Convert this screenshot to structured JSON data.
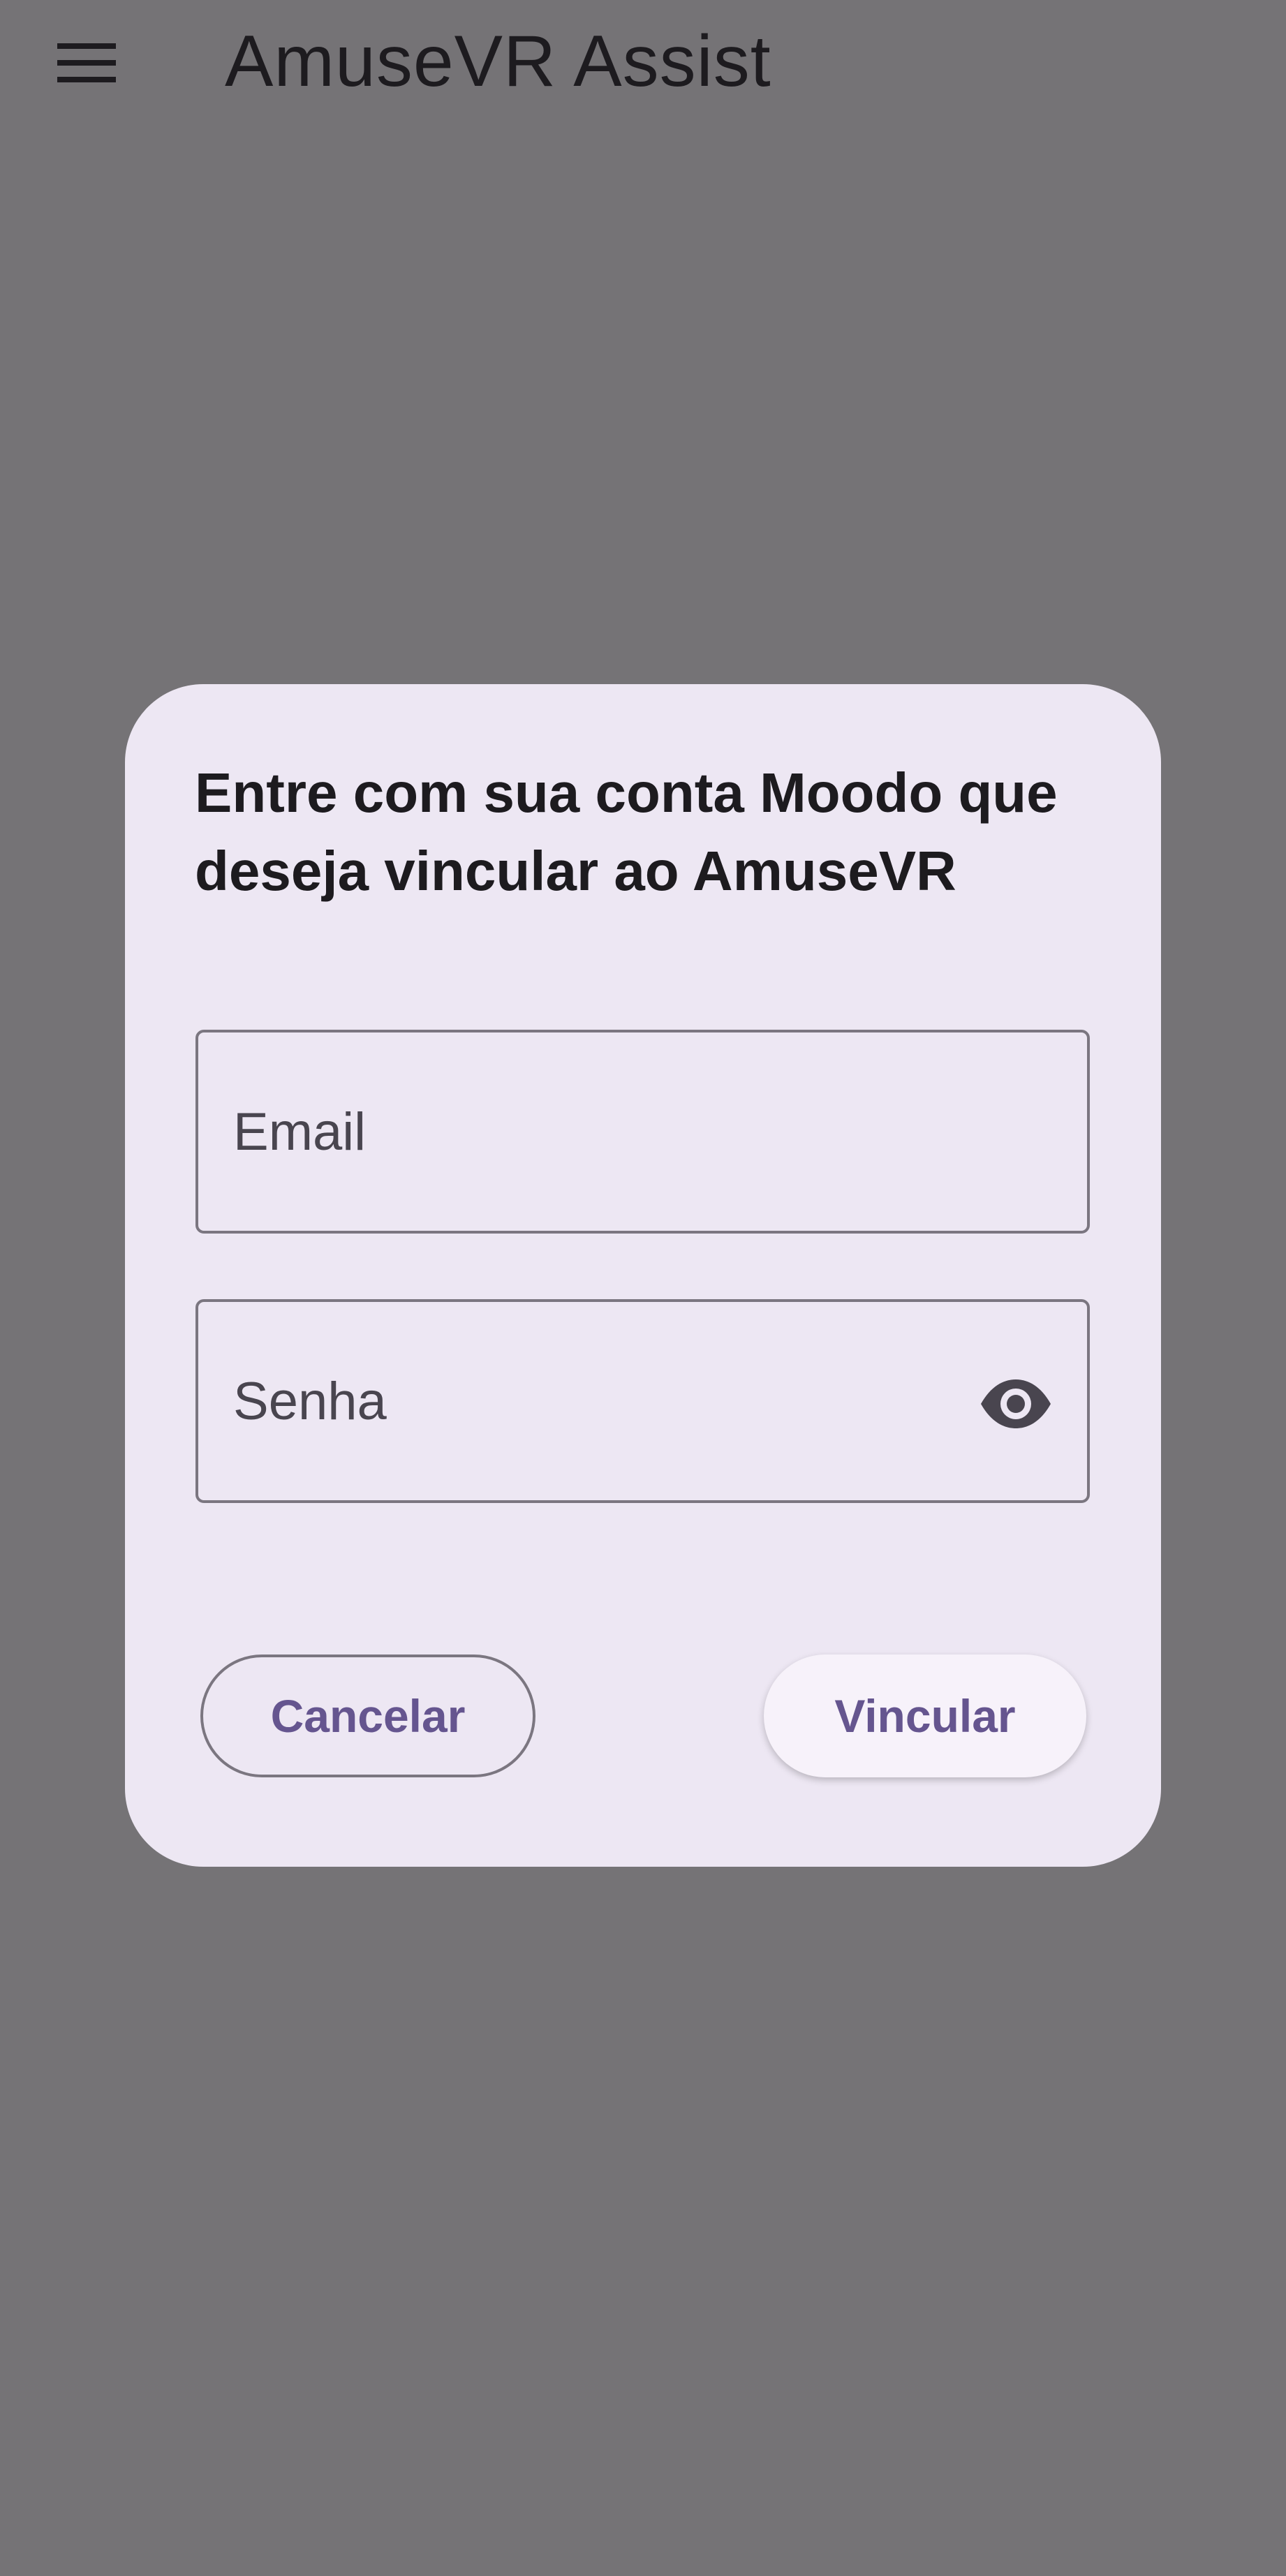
{
  "app_bar": {
    "title": "AmuseVR Assist",
    "menu_icon": "hamburger-menu-icon"
  },
  "dialog": {
    "title": "Entre com sua conta Moodo que deseja vincular ao AmuseVR",
    "email_field": {
      "placeholder": "Email",
      "value": ""
    },
    "password_field": {
      "placeholder": "Senha",
      "value": "",
      "toggle_icon": "eye-icon"
    },
    "actions": {
      "cancel_label": "Cancelar",
      "confirm_label": "Vincular"
    }
  },
  "colors": {
    "scrim": "#757376",
    "dialog_surface": "#ede7f3",
    "primary": "#65558f",
    "on_surface": "#1d1b1f",
    "on_surface_variant": "#49454f",
    "outline": "#7b7680"
  }
}
